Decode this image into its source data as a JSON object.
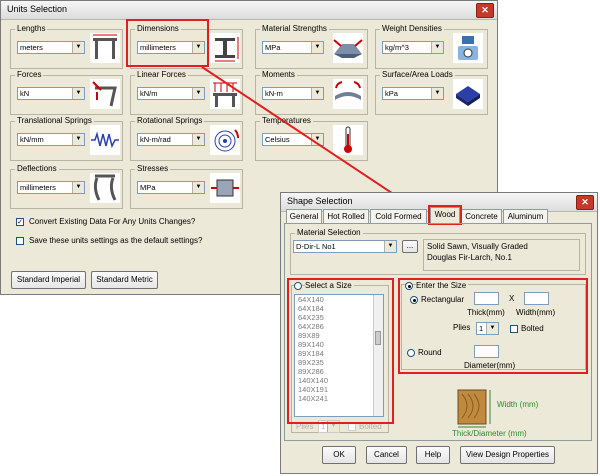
{
  "units_window": {
    "title": "Units Selection",
    "close_glyph": "✕",
    "groups": {
      "lengths": {
        "label": "Lengths",
        "value": "meters",
        "icon": "lengths-icon"
      },
      "dimensions": {
        "label": "Dimensions",
        "value": "millimeters",
        "icon": "dimensions-icon"
      },
      "material_strengths": {
        "label": "Material Strengths",
        "value": "MPa",
        "icon": "material-strengths-icon"
      },
      "weight_densities": {
        "label": "Weight Densities",
        "value": "kg/m^3",
        "icon": "weight-densities-icon"
      },
      "forces": {
        "label": "Forces",
        "value": "kN",
        "icon": "forces-icon"
      },
      "linear_forces": {
        "label": "Linear Forces",
        "value": "kN/m",
        "icon": "linear-forces-icon"
      },
      "moments": {
        "label": "Moments",
        "value": "kN-m",
        "icon": "moments-icon"
      },
      "surface_area_loads": {
        "label": "Surface/Area Loads",
        "value": "kPa",
        "icon": "surface-loads-icon"
      },
      "translational_springs": {
        "label": "Translational Springs",
        "value": "kN/mm",
        "icon": "translational-springs-icon"
      },
      "rotational_springs": {
        "label": "Rotational Springs",
        "value": "kN-m/rad",
        "icon": "rotational-springs-icon"
      },
      "temperatures": {
        "label": "Temperatures",
        "value": "Celsius",
        "icon": "thermometer-icon"
      },
      "deflections": {
        "label": "Deflections",
        "value": "millimeters",
        "icon": "deflections-icon"
      },
      "stresses": {
        "label": "Stresses",
        "value": "MPa",
        "icon": "stresses-icon"
      }
    },
    "convert_label": "Convert Existing Data For Any Units Changes?",
    "convert_checked": true,
    "default_label": "Save these units settings as the default settings?",
    "default_checked": false,
    "standard_imperial": "Standard Imperial",
    "standard_metric": "Standard Metric"
  },
  "shape_window": {
    "title": "Shape Selection",
    "close_glyph": "✕",
    "tabs": [
      "General",
      "Hot Rolled",
      "Cold Formed",
      "Wood",
      "Concrete",
      "Aluminum"
    ],
    "active_tab": "Wood",
    "material_selection_label": "Material Selection",
    "material_value": "D-Dir-L No1",
    "browse_label": "...",
    "material_desc_line1": "Solid Sawn, Visually Graded",
    "material_desc_line2": "Douglas Fir-Larch, No.1",
    "select_size_label": "Select a Size",
    "sizes": [
      "64X140",
      "64X184",
      "64X235",
      "64X286",
      "89X89",
      "89X140",
      "89X184",
      "89X235",
      "89X286",
      "140X140",
      "140X191",
      "140X241"
    ],
    "plies_disabled_label": "Plies",
    "plies_disabled_value": "1",
    "bolted_disabled_label": "Bolted",
    "enter_size_label": "Enter the Size",
    "rectangular_label": "Rectangular",
    "x_label": "X",
    "thick_label": "Thick(mm)",
    "width_label": "Width(mm)",
    "plies_label": "Plies",
    "plies_value": "1",
    "bolted_label": "Bolted",
    "round_label": "Round",
    "diameter_label": "Diameter(mm)",
    "width_mm_label": "Width (mm)",
    "thick_diameter_label": "Thick/Diameter (mm)",
    "ok": "OK",
    "cancel": "Cancel",
    "help": "Help",
    "view_props": "View Design Properties"
  },
  "colors": {
    "highlight": "#e02020",
    "dim_green": "#2f8a2f"
  }
}
